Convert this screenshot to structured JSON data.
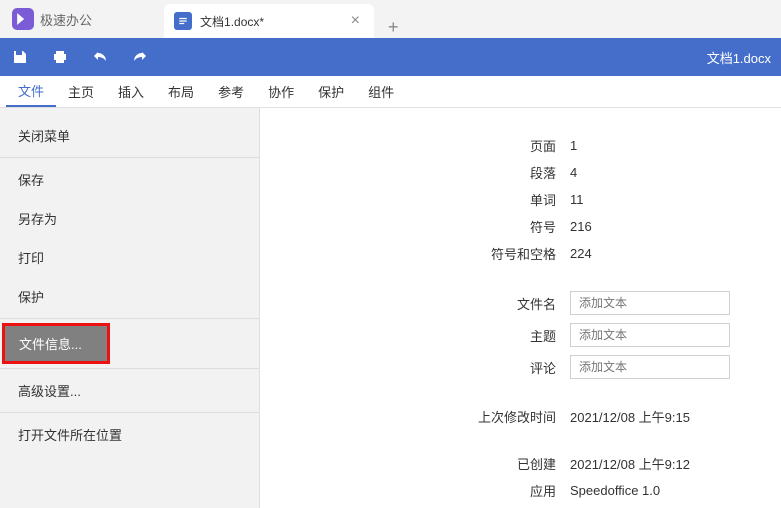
{
  "app": {
    "name": "极速办公"
  },
  "tab": {
    "label": "文档1.docx*"
  },
  "toolbar": {
    "title": "文档1.docx"
  },
  "menu": {
    "file": "文件",
    "home": "主页",
    "insert": "插入",
    "layout": "布局",
    "reference": "参考",
    "collab": "协作",
    "protect": "保护",
    "component": "组件"
  },
  "sidebar": {
    "closeMenu": "关闭菜单",
    "save": "保存",
    "saveAs": "另存为",
    "print": "打印",
    "protect": "保护",
    "fileInfo": "文件信息...",
    "advanced": "高级设置...",
    "openLocation": "打开文件所在位置"
  },
  "info": {
    "pages_l": "页面",
    "pages_v": "1",
    "paras_l": "段落",
    "paras_v": "4",
    "words_l": "单词",
    "words_v": "11",
    "symbols_l": "符号",
    "symbols_v": "216",
    "symspace_l": "符号和空格",
    "symspace_v": "224",
    "filename_l": "文件名",
    "subject_l": "主题",
    "comments_l": "评论",
    "lastmod_l": "上次修改时间",
    "lastmod_v": "2021/12/08 上午9:15",
    "created_l": "已创建",
    "created_v": "2021/12/08 上午9:12",
    "application_l": "应用",
    "application_v": "Speedoffice 1.0",
    "placeholder": "添加文本"
  }
}
